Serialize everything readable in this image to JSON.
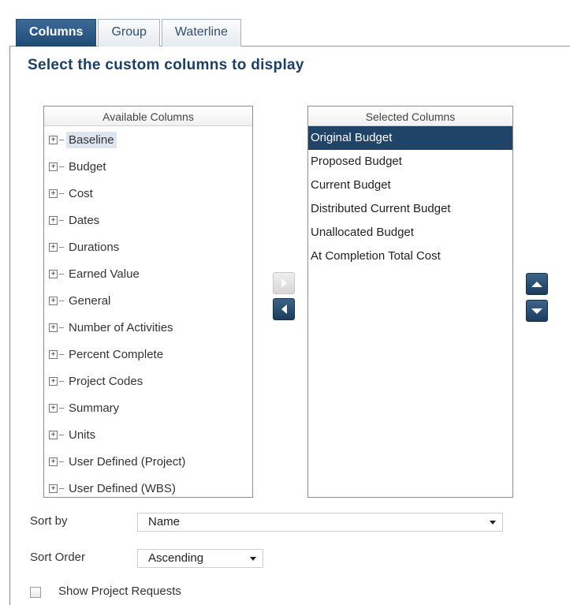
{
  "tabs": [
    {
      "label": "Columns",
      "active": true
    },
    {
      "label": "Group",
      "active": false
    },
    {
      "label": "Waterline",
      "active": false
    }
  ],
  "title": "Select the custom columns to display",
  "available": {
    "header": "Available Columns",
    "items": [
      "Baseline",
      "Budget",
      "Cost",
      "Dates",
      "Durations",
      "Earned Value",
      "General",
      "Number of Activities",
      "Percent Complete",
      "Project Codes",
      "Summary",
      "Units",
      "User Defined (Project)",
      "User Defined (WBS)"
    ]
  },
  "selected": {
    "header": "Selected Columns",
    "items": [
      "Original Budget",
      "Proposed Budget",
      "Current Budget",
      "Distributed Current Budget",
      "Unallocated Budget",
      "At Completion Total Cost"
    ]
  },
  "icons": {
    "add": "arrow-right-icon",
    "remove": "arrow-left-icon",
    "move_up": "arrow-up-icon",
    "move_down": "arrow-down-icon",
    "expand": "plus-icon"
  },
  "sort_by": {
    "label": "Sort by",
    "value": "Name"
  },
  "sort_order": {
    "label": "Sort Order",
    "value": "Ascending"
  },
  "show_requests": {
    "label": "Show Project Requests",
    "checked": false
  },
  "colors": {
    "accent": "#1f4468",
    "title": "#1b3f66"
  }
}
